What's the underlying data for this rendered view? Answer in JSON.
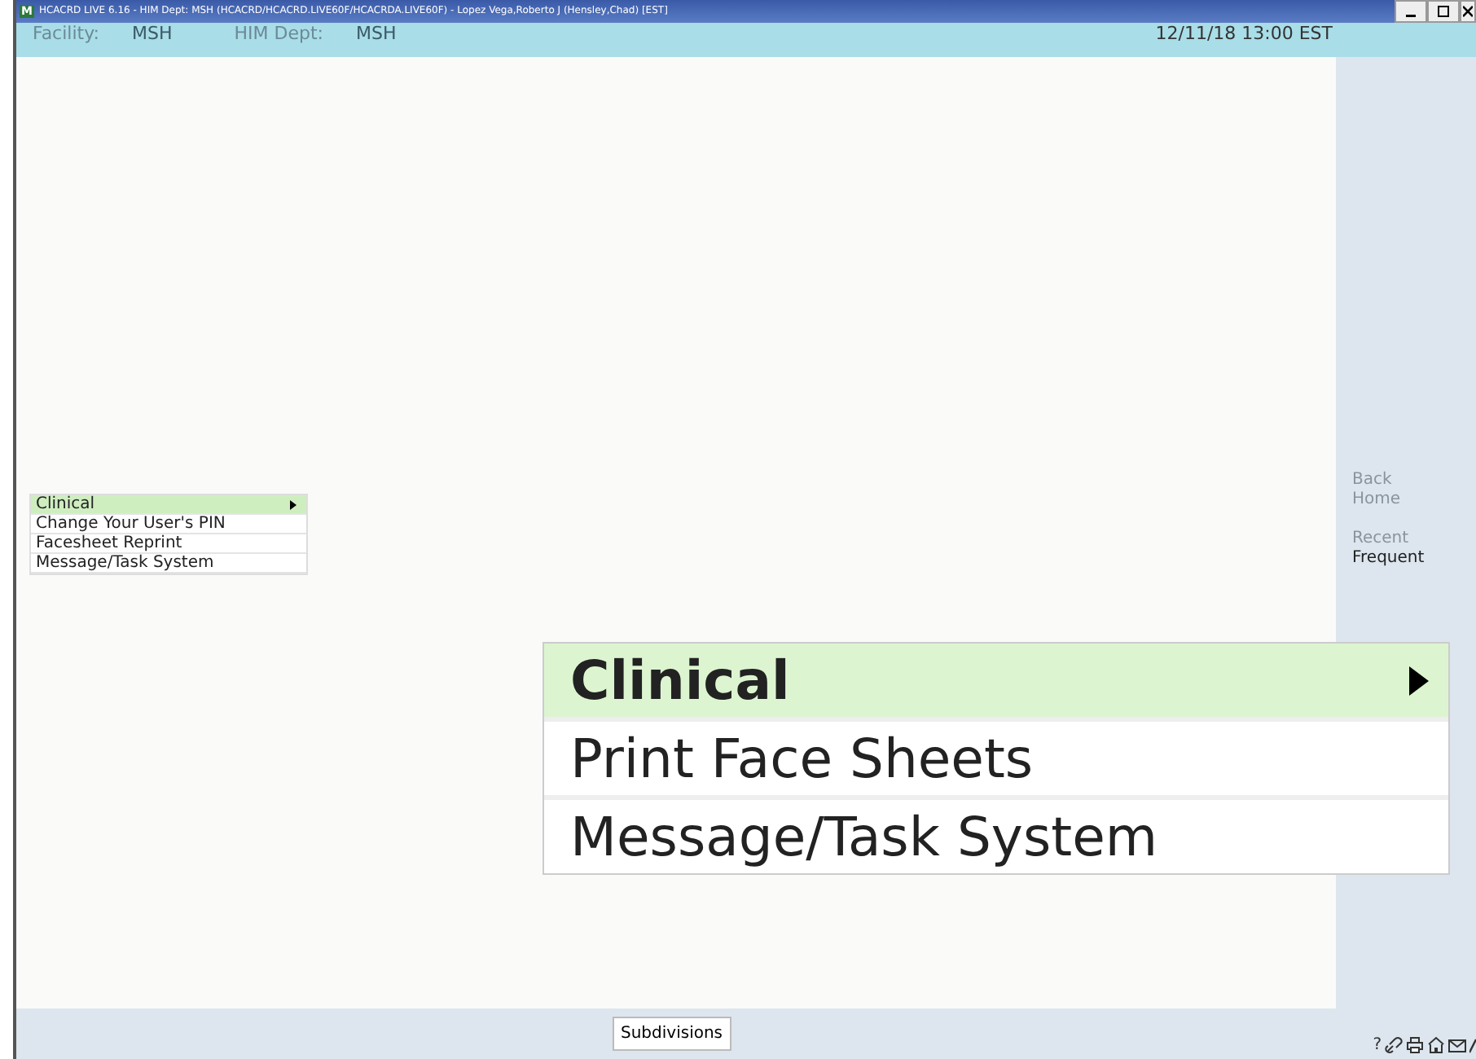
{
  "window": {
    "title": "HCACRD LIVE 6.16 - HIM Dept: MSH (HCACRD/HCACRD.LIVE60F/HCACRDA.LIVE60F) - Lopez Vega,Roberto J (Hensley,Chad) [EST]",
    "app_letter": "M"
  },
  "header": {
    "fields": [
      {
        "label": "Facility:",
        "value": "MSH"
      },
      {
        "label": "HIM Dept:",
        "value": "MSH"
      }
    ],
    "datetime": "12/11/18 13:00 EST"
  },
  "small_menu": [
    {
      "label": "Clinical",
      "selected": true,
      "submenu": true
    },
    {
      "label": "Change Your User's PIN",
      "selected": false,
      "submenu": false
    },
    {
      "label": "Facesheet Reprint",
      "selected": false,
      "submenu": false
    },
    {
      "label": "Message/Task System",
      "selected": false,
      "submenu": false
    }
  ],
  "large_menu": [
    {
      "label": "Clinical",
      "selected": true,
      "submenu": true
    },
    {
      "label": "Print Face Sheets",
      "selected": false,
      "submenu": false
    },
    {
      "label": "Message/Task System",
      "selected": false,
      "submenu": false
    }
  ],
  "sidebar": {
    "groups": [
      [
        {
          "label": "Back",
          "disabled": true
        },
        {
          "label": "Home",
          "disabled": true
        }
      ],
      [
        {
          "label": "Recent",
          "disabled": true
        },
        {
          "label": "Frequent",
          "disabled": false
        }
      ]
    ]
  },
  "footer": {
    "button": "Subdivisions",
    "help": "?"
  }
}
